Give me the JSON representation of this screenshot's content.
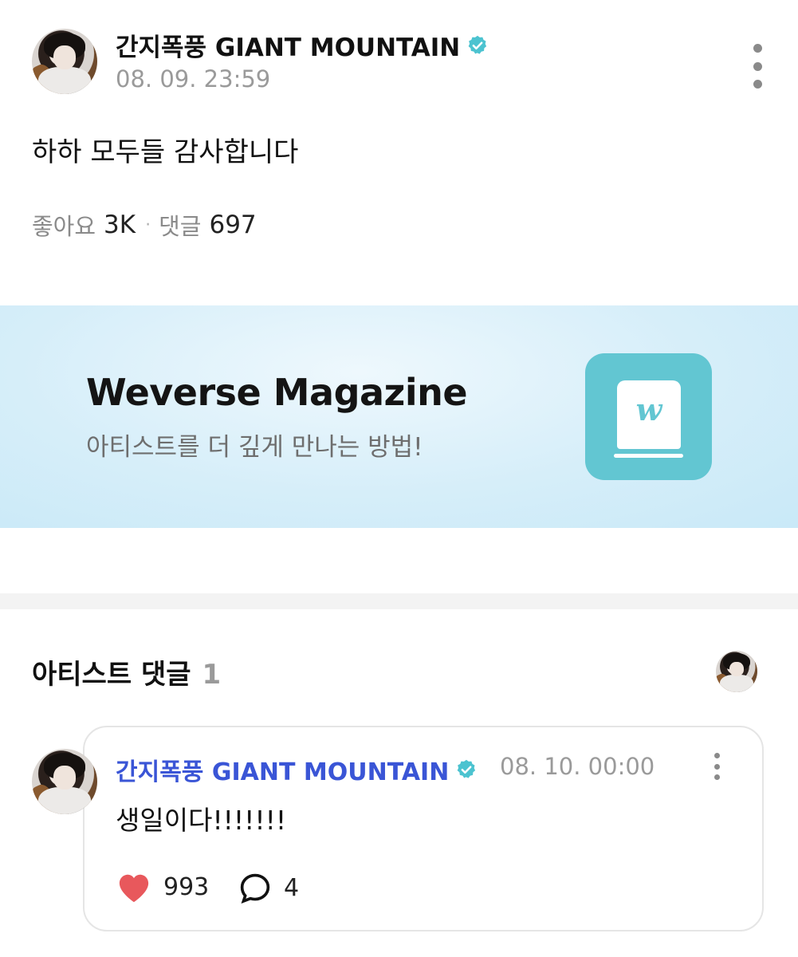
{
  "post": {
    "author": "간지폭풍 GIANT MOUNTAIN",
    "date": "08. 09. 23:59",
    "body": "하하 모두들 감사합니다",
    "likes_label": "좋아요",
    "likes_count": "3K",
    "comments_label": "댓글",
    "comments_count": "697"
  },
  "banner": {
    "title": "Weverse Magazine",
    "subtitle": "아티스트를 더 깊게 만나는 방법!",
    "logo_glyph": "w",
    "logo_color": "#62c6d2"
  },
  "artist_comments": {
    "heading": "아티스트 댓글",
    "count": "1",
    "comment": {
      "author": "간지폭풍 GIANT MOUNTAIN",
      "date": "08. 10. 00:00",
      "body": "생일이다!!!!!!!",
      "like_count": "993",
      "reply_count": "4",
      "author_color": "#3a55d6",
      "heart_color": "#e8585c"
    }
  },
  "colors": {
    "verified": "#4cc3d0",
    "muted_text": "#9a9a9a"
  },
  "icons": [
    "verified-badge-icon",
    "more-vertical-icon",
    "heart-icon",
    "reply-bubble-icon",
    "weverse-book-icon"
  ]
}
